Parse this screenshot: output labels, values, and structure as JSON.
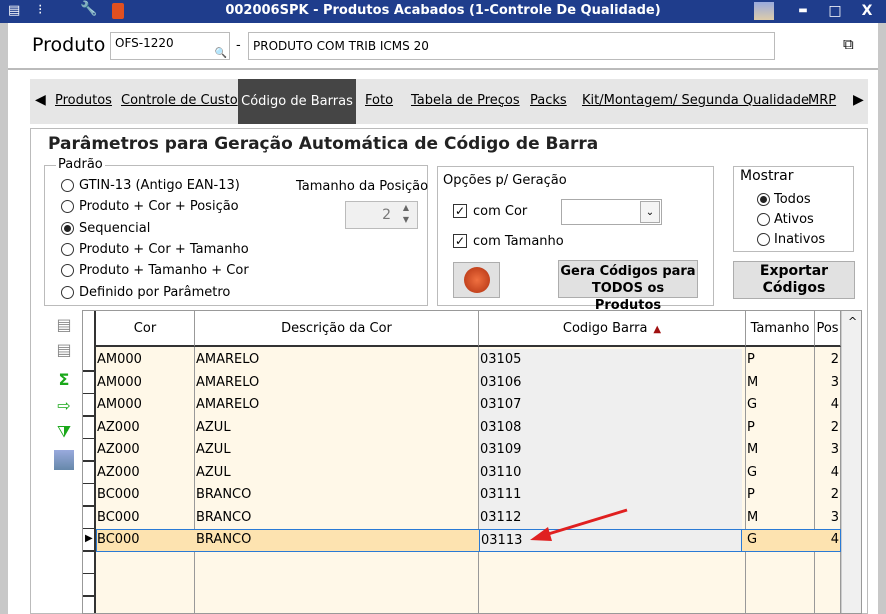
{
  "window": {
    "title": "002006SPK - Produtos Acabados (1-Controle De Qualidade)",
    "minimize": "▬",
    "maximize": "□",
    "close": "X"
  },
  "header": {
    "produto_label": "Produto",
    "produto_code": "OFS-1220",
    "dash": "-",
    "produto_desc": "PRODUTO COM TRIB ICMS 20"
  },
  "tabs": [
    {
      "label": "Produtos"
    },
    {
      "label": "Controle de Custo"
    },
    {
      "label": "Código de Barras",
      "active": true
    },
    {
      "label": "Foto"
    },
    {
      "label": "Tabela de Preços"
    },
    {
      "label": "Packs"
    },
    {
      "label": "Kit/Montagem/ Segunda Qualidade"
    },
    {
      "label": "MRP"
    }
  ],
  "panel": {
    "title": "Parâmetros para Geração Automática de Código de Barra",
    "padrao": {
      "label": "Padrão",
      "options": [
        "GTIN-13 (Antigo EAN-13)",
        "Produto + Cor + Posição",
        "Sequencial",
        "Produto + Cor + Tamanho",
        "Produto + Tamanho + Cor",
        "Definido por Parâmetro"
      ],
      "selected": 2,
      "tamanho_label": "Tamanho da Posição",
      "tamanho_value": "2"
    },
    "opcoes": {
      "label": "Opções p/ Geração",
      "com_cor": "com Cor",
      "com_cor_checked": true,
      "com_tamanho": "com Tamanho",
      "com_tamanho_checked": true,
      "select_value": "",
      "gera_button": "Gera Códigos para TODOS os Produtos"
    },
    "mostrar": {
      "label": "Mostrar",
      "options": [
        "Todos",
        "Ativos",
        "Inativos"
      ],
      "selected": 0
    },
    "exportar_button": "Exportar Códigos"
  },
  "grid": {
    "columns": [
      "Cor",
      "Descrição da Cor",
      "Codigo Barra",
      "Tamanho",
      "Pos"
    ],
    "sort_indicator": "▲",
    "rows": [
      [
        "AM000",
        "AMARELO",
        "03105",
        "P",
        "2"
      ],
      [
        "AM000",
        "AMARELO",
        "03106",
        "M",
        "3"
      ],
      [
        "AM000",
        "AMARELO",
        "03107",
        "G",
        "4"
      ],
      [
        "AZ000",
        "AZUL",
        "03108",
        "P",
        "2"
      ],
      [
        "AZ000",
        "AZUL",
        "03109",
        "M",
        "3"
      ],
      [
        "AZ000",
        "AZUL",
        "03110",
        "G",
        "4"
      ],
      [
        "BC000",
        "BRANCO",
        "03111",
        "P",
        "2"
      ],
      [
        "BC000",
        "BRANCO",
        "03112",
        "M",
        "3"
      ],
      [
        "BC000",
        "BRANCO",
        "03113",
        "G",
        "4"
      ]
    ],
    "selected_row": 8
  },
  "colors": {
    "titlebar": "#1f3d8c",
    "active_tab": "#454545",
    "row_bg": "#fff8e8",
    "selected_row": "#fde3b0",
    "annotation_arrow": "#e02020"
  }
}
